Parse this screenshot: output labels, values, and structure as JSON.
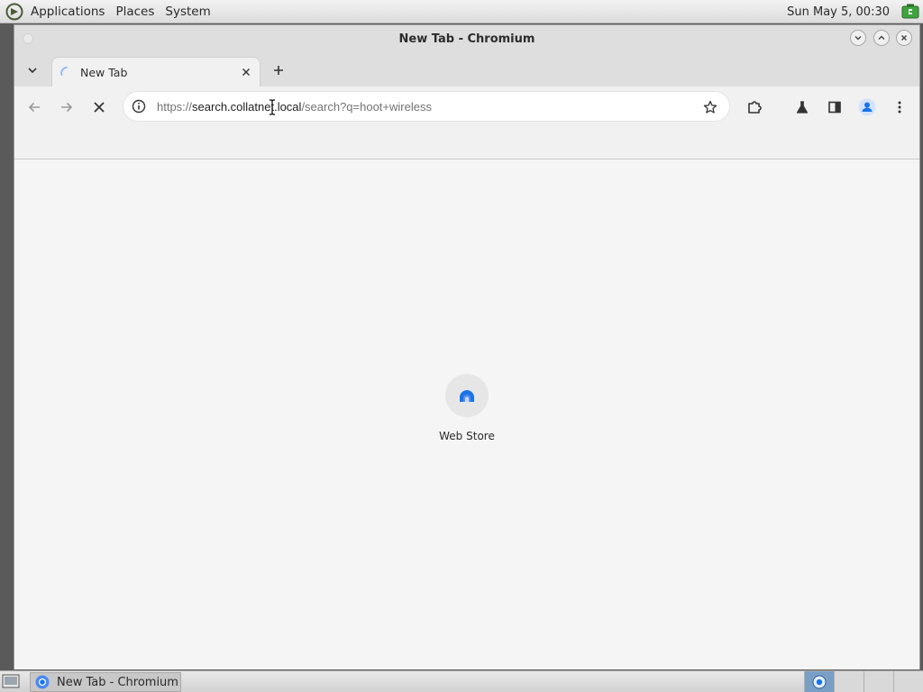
{
  "top_panel": {
    "menus": [
      "Applications",
      "Places",
      "System"
    ],
    "clock": "Sun May  5, 00:30",
    "icons": {
      "distro_logo": "distro-logo-icon",
      "battery": "battery-icon"
    }
  },
  "window": {
    "title": "New Tab - Chromium",
    "controls": [
      "minimize-icon",
      "maximize-icon",
      "close-icon"
    ]
  },
  "tabs": {
    "active_tab_title": "New Tab",
    "loading": true
  },
  "toolbar": {
    "url_scheme": "https://",
    "url_host": "search.collatnet.local",
    "url_path": "/search?q=hoot+wireless",
    "icons": [
      "back-icon",
      "forward-icon",
      "stop-icon",
      "site-info-icon",
      "bookmark-star-icon",
      "extensions-icon",
      "labs-icon",
      "side-panel-icon",
      "profile-icon",
      "menu-icon"
    ]
  },
  "content": {
    "shortcuts": [
      {
        "label": "Web Store",
        "icon": "web-store-icon"
      }
    ]
  },
  "taskbar": {
    "item_label": "New Tab - Chromium",
    "workspace_count": 4,
    "active_workspace": 1
  },
  "colors": {
    "accent": "#1a73e8",
    "page_bg": "#f5f5f5",
    "chrome_bg": "#dedede"
  }
}
